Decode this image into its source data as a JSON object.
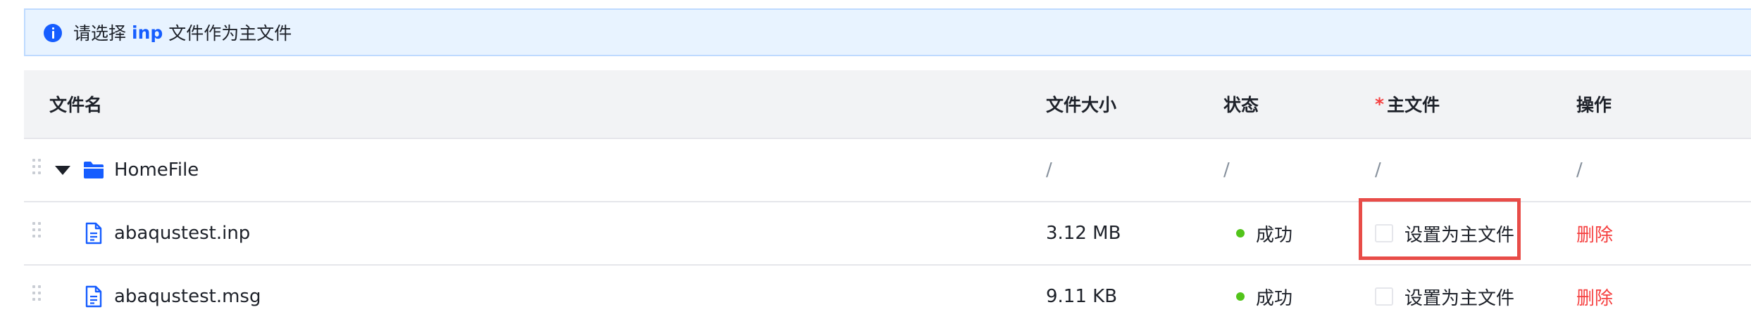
{
  "banner": {
    "icon": "info-icon",
    "prefix": "请选择",
    "highlight": "inp",
    "suffix": "文件作为主文件"
  },
  "table": {
    "columns": {
      "name": "文件名",
      "size": "文件大小",
      "status": "状态",
      "main_required_mark": "*",
      "main": "主文件",
      "actions": "操作"
    },
    "rows": [
      {
        "type": "folder",
        "icon": "folder-icon",
        "expanded": true,
        "name": "HomeFile",
        "size": "/",
        "status": "/",
        "main": "/",
        "actions": "/"
      },
      {
        "type": "file",
        "icon": "file-icon",
        "name": "abaqustest.inp",
        "size": "3.12 MB",
        "status": "成功",
        "status_color": "#52c41a",
        "main_checkbox_label": "设置为主文件",
        "main_checked": false,
        "delete_label": "删除",
        "highlighted": true
      },
      {
        "type": "file",
        "icon": "file-icon",
        "name": "abaqustest.msg",
        "size": "9.11 KB",
        "status": "成功",
        "status_color": "#52c41a",
        "main_checkbox_label": "设置为主文件",
        "main_checked": false,
        "delete_label": "删除"
      }
    ]
  },
  "colors": {
    "accent": "#165dff",
    "danger": "#f53f3f",
    "success": "#52c41a",
    "annotation": "#e84c48"
  }
}
